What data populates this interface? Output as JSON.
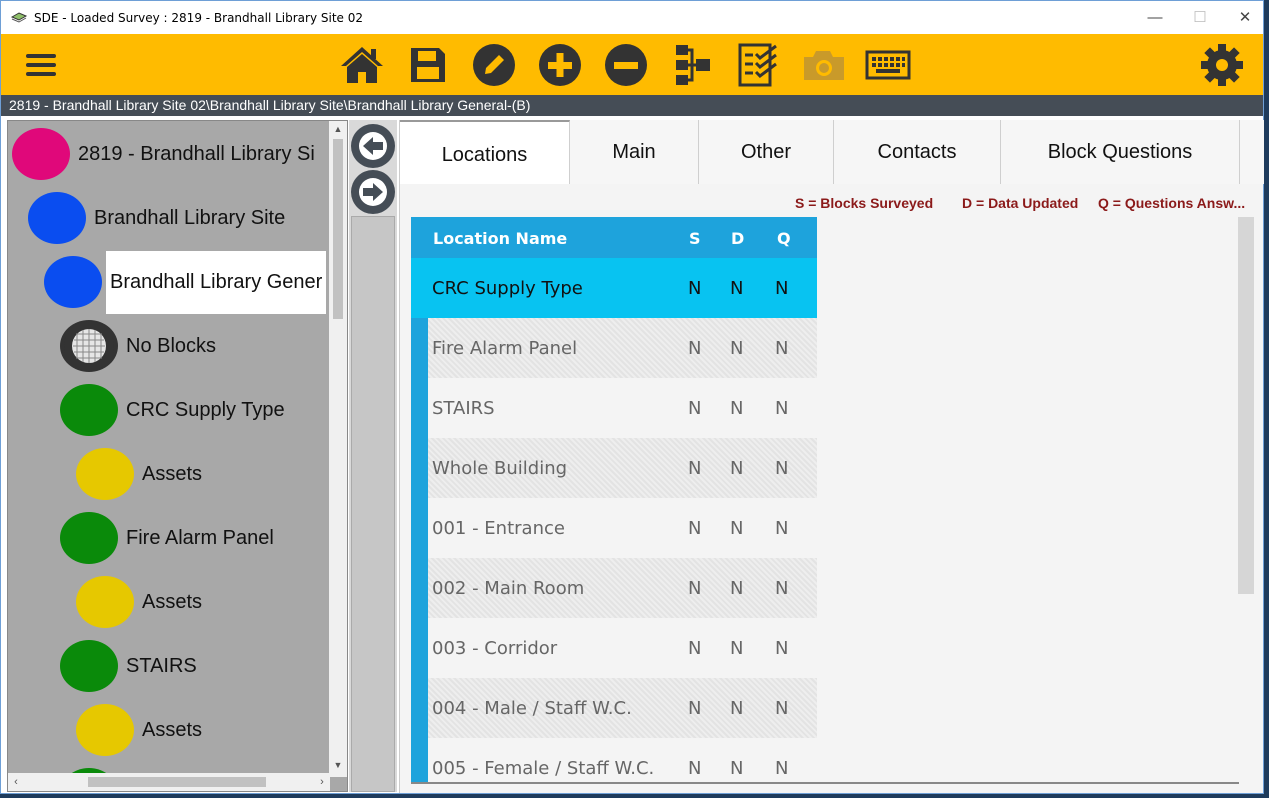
{
  "window": {
    "title": "SDE - Loaded Survey : 2819 - Brandhall Library Site 02",
    "controls": {
      "minimize": "—",
      "maximize": "☐",
      "close": "✕"
    }
  },
  "toolbar": {
    "color": "#ffbb00",
    "buttons": [
      "menu-icon",
      "home-icon",
      "save-icon",
      "edit-icon",
      "add-icon",
      "remove-icon",
      "hierarchy-icon",
      "checklist-icon",
      "camera-icon",
      "keyboard-icon",
      "gear-icon"
    ]
  },
  "breadcrumb": "2819 - Brandhall Library Site 02\\Brandhall Library Site\\Brandhall Library General-(B)",
  "tree": {
    "items": [
      {
        "label": "2819 - Brandhall Library Si",
        "color": "#e0087a"
      },
      {
        "label": "Brandhall Library Site",
        "color": "#0a4df0"
      },
      {
        "label": "Brandhall Library Gener",
        "color": "#0a4df0",
        "selected": true
      },
      {
        "label": "No Blocks",
        "color": "mesh"
      },
      {
        "label": "CRC Supply Type",
        "color": "#0a8a0a"
      },
      {
        "label": "Assets",
        "color": "#e6c800"
      },
      {
        "label": "Fire Alarm Panel",
        "color": "#0a8a0a"
      },
      {
        "label": "Assets",
        "color": "#e6c800"
      },
      {
        "label": "STAIRS",
        "color": "#0a8a0a"
      },
      {
        "label": "Assets",
        "color": "#e6c800"
      }
    ]
  },
  "tabs": [
    "Locations",
    "Main",
    "Other",
    "Contacts",
    "Block Questions"
  ],
  "legend": {
    "s": "S = Blocks Surveyed",
    "d": "D = Data Updated",
    "q": "Q = Questions Answ..."
  },
  "grid": {
    "headers": {
      "name": "Location Name",
      "s": "S",
      "d": "D",
      "q": "Q"
    },
    "rows": [
      {
        "name": "CRC Supply Type",
        "s": "N",
        "d": "N",
        "q": "N"
      },
      {
        "name": "Fire Alarm Panel",
        "s": "N",
        "d": "N",
        "q": "N"
      },
      {
        "name": "STAIRS",
        "s": "N",
        "d": "N",
        "q": "N"
      },
      {
        "name": "Whole Building",
        "s": "N",
        "d": "N",
        "q": "N"
      },
      {
        "name": "001 - Entrance",
        "s": "N",
        "d": "N",
        "q": "N"
      },
      {
        "name": "002 - Main Room",
        "s": "N",
        "d": "N",
        "q": "N"
      },
      {
        "name": "003 - Corridor",
        "s": "N",
        "d": "N",
        "q": "N"
      },
      {
        "name": "004 - Male / Staff W.C.",
        "s": "N",
        "d": "N",
        "q": "N"
      },
      {
        "name": "005 - Female / Staff W.C.",
        "s": "N",
        "d": "N",
        "q": "N"
      }
    ]
  }
}
